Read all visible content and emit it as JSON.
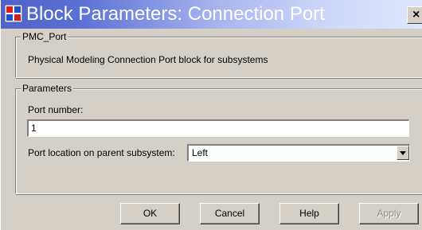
{
  "window": {
    "title": "Block Parameters: Connection Port",
    "close_glyph": "×",
    "app_icon": "simulink-block-icon"
  },
  "description_group": {
    "label": "PMC_Port",
    "text": "Physical Modeling Connection Port block for subsystems"
  },
  "parameters_group": {
    "label": "Parameters",
    "port_number": {
      "label": "Port number:",
      "value": "1"
    },
    "port_location": {
      "label": "Port location on parent subsystem:",
      "selected": "Left"
    }
  },
  "buttons": {
    "ok": "OK",
    "cancel": "Cancel",
    "help": "Help",
    "apply": "Apply"
  },
  "colors": {
    "dialog_bg": "#d4d0c8",
    "title_gradient_start": "#4f63c8",
    "title_gradient_end": "#dfe6fc",
    "disabled_text": "#8c8a84"
  }
}
